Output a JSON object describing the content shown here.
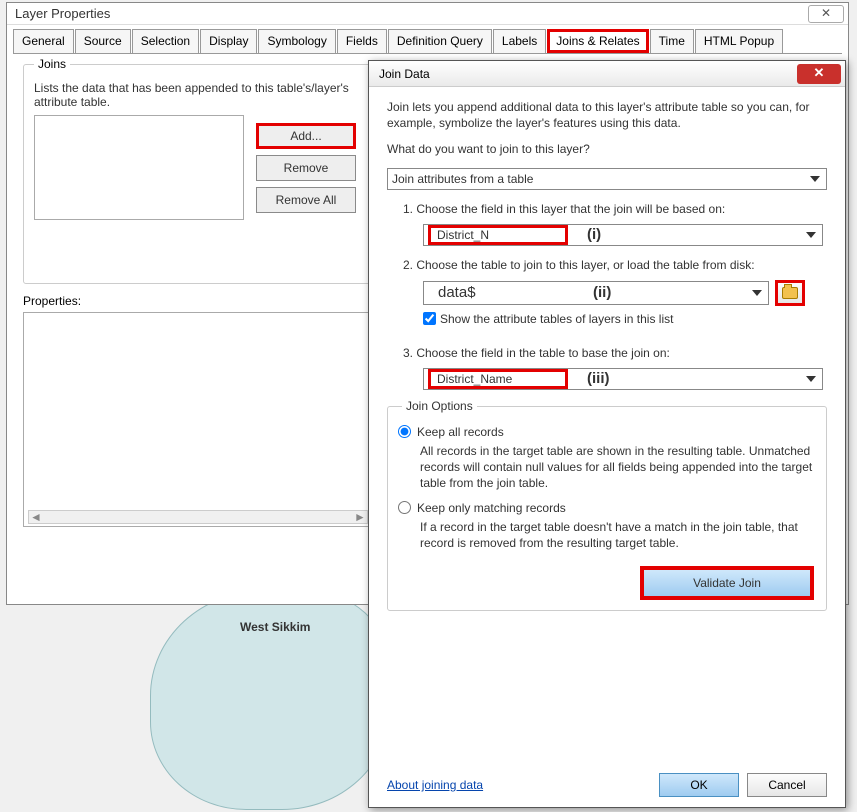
{
  "layerProps": {
    "title": "Layer Properties",
    "tabs": [
      "General",
      "Source",
      "Selection",
      "Display",
      "Symbology",
      "Fields",
      "Definition Query",
      "Labels",
      "Joins & Relates",
      "Time",
      "HTML Popup"
    ],
    "joins": {
      "legend": "Joins",
      "desc": "Lists the data that has been appended to this table's/layer's attribute table.",
      "buttons": {
        "add": "Add...",
        "remove": "Remove",
        "removeAll": "Remove All"
      }
    },
    "propsLabel": "Properties:"
  },
  "map": {
    "label1": "West Sikkim"
  },
  "joinDialog": {
    "title": "Join Data",
    "intro": "Join lets you append additional data to this layer's attribute table so you can, for example, symbolize the layer's features using this data.",
    "prompt": "What do you want to join to this layer?",
    "mainSelect": "Join attributes from a table",
    "step1": "1.   Choose the field in this layer that the join will be based on:",
    "field1": "District_N",
    "ann1": "(i)",
    "step2": "2.   Choose the table to join to this layer, or load the table from disk:",
    "table": "data$",
    "ann2": "(ii)",
    "showAttr": "Show the attribute tables of layers in this list",
    "step3": "3.   Choose the field in the table to base the join on:",
    "field3": "District_Name",
    "ann3": "(iii)",
    "joinOptions": {
      "legend": "Join Options",
      "opt1": "Keep all records",
      "desc1": "All records in the target table are shown in the resulting table. Unmatched records will contain null values for all fields being appended into the target table from the join table.",
      "opt2": "Keep only matching records",
      "desc2": "If a record in the target table doesn't have a match in the join table, that record is removed from the resulting target table."
    },
    "validate": "Validate Join",
    "link": "About joining data",
    "ok": "OK",
    "cancel": "Cancel"
  }
}
